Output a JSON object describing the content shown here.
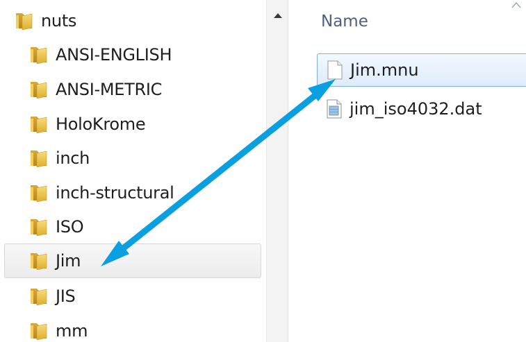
{
  "tree": {
    "items": [
      {
        "label": "nuts"
      },
      {
        "label": "ANSI-ENGLISH"
      },
      {
        "label": "ANSI-METRIC"
      },
      {
        "label": "HoloKrome"
      },
      {
        "label": "inch"
      },
      {
        "label": "inch-structural"
      },
      {
        "label": "ISO"
      },
      {
        "label": "Jim"
      },
      {
        "label": "JIS"
      },
      {
        "label": "mm"
      }
    ],
    "selected_item": "Jim"
  },
  "file_list": {
    "column_header": "Name",
    "files": [
      {
        "name": "Jim.mnu",
        "icon": "blank-document-icon",
        "selected": true
      },
      {
        "name": "jim_iso4032.dat",
        "icon": "data-file-icon",
        "selected": false
      }
    ]
  },
  "annotation": {
    "type": "double-headed-arrow",
    "color": "#0a9fe0",
    "connects": [
      "Jim",
      "Jim.mnu"
    ]
  },
  "colors": {
    "folder": "#e9c04a",
    "selection_border": "#84acdd",
    "header_text": "#4d6082"
  }
}
